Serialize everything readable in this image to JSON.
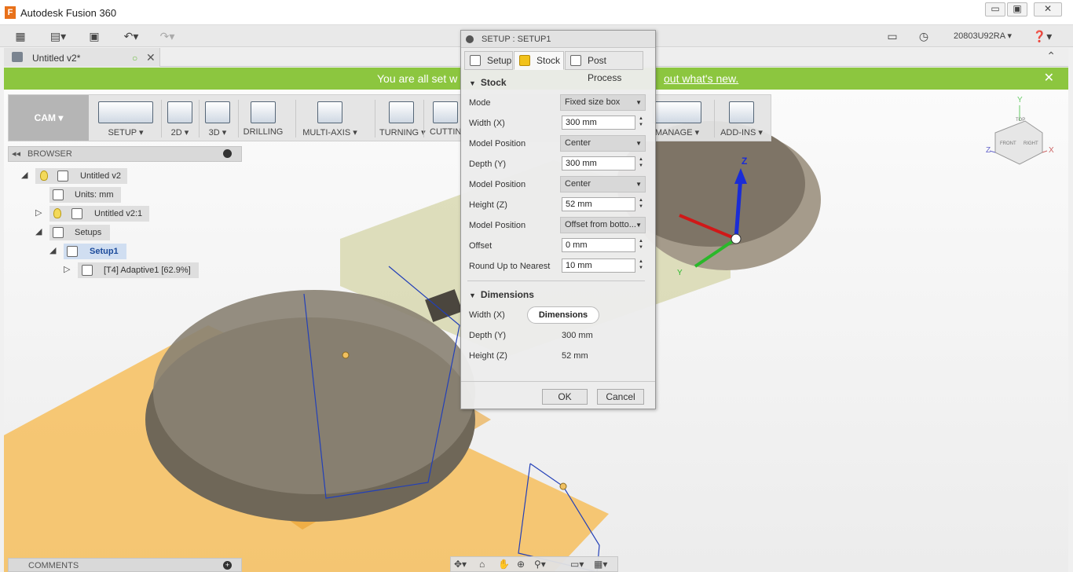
{
  "app": {
    "title": "Autodesk Fusion 360",
    "user": "20803U92RA"
  },
  "window_buttons": {
    "min": "▭",
    "max": "▣",
    "close": "✕"
  },
  "document": {
    "tab_name": "Untitled v2*"
  },
  "banner": {
    "text_left": "You are all set w",
    "text_link": "out what's new.",
    "close": "✕"
  },
  "ribbon": {
    "workspace": "CAM ▾",
    "groups": [
      {
        "label": "SETUP ▾"
      },
      {
        "label": "2D ▾"
      },
      {
        "label": "3D ▾"
      },
      {
        "label": "DRILLING"
      },
      {
        "label": "MULTI-AXIS ▾"
      },
      {
        "label": "TURNING ▾"
      },
      {
        "label": "CUTTIN"
      },
      {
        "label": "MANAGE ▾"
      },
      {
        "label": "ADD-INS ▾"
      }
    ]
  },
  "browser": {
    "title": "BROWSER",
    "tree": [
      {
        "label": "Untitled v2"
      },
      {
        "label": "Units: mm"
      },
      {
        "label": "Untitled v2:1"
      },
      {
        "label": "Setups"
      },
      {
        "label": "Setup1"
      },
      {
        "label": "[T4] Adaptive1 [62.9%]"
      }
    ]
  },
  "comments": {
    "title": "COMMENTS"
  },
  "dialog": {
    "title": "SETUP : SETUP1",
    "tabs": [
      {
        "label": "Setup"
      },
      {
        "label": "Stock"
      },
      {
        "label": "Post Process"
      }
    ],
    "stock_section": "Stock",
    "fields": {
      "mode": {
        "label": "Mode",
        "value": "Fixed size box"
      },
      "width": {
        "label": "Width (X)",
        "value": "300 mm"
      },
      "model_position_x": {
        "label": "Model Position",
        "value": "Center"
      },
      "depth": {
        "label": "Depth (Y)",
        "value": "300 mm"
      },
      "model_position_y": {
        "label": "Model Position",
        "value": "Center"
      },
      "height": {
        "label": "Height (Z)",
        "value": "52 mm"
      },
      "model_position_z": {
        "label": "Model Position",
        "value": "Offset from botto..."
      },
      "offset": {
        "label": "Offset",
        "value": "0 mm"
      },
      "round_up": {
        "label": "Round Up to Nearest",
        "value": "10 mm"
      }
    },
    "dimensions_section": "Dimensions",
    "dimensions": {
      "width_label": "Width (X)",
      "width_tooltip": "Dimensions",
      "depth_label": "Depth (Y)",
      "depth_value": "300 mm",
      "height_label": "Height (Z)",
      "height_value": "52 mm"
    },
    "ok": "OK",
    "cancel": "Cancel"
  },
  "viewcube": {
    "top": "TOP",
    "front": "FRONT",
    "right": "RIGHT",
    "x": "X",
    "y": "Y",
    "z": "Z"
  },
  "triad": {
    "z": "Z",
    "y": "Y"
  },
  "colors": {
    "banner": "#8cc63f",
    "stock": "#f5b13c",
    "accent": "#1c4b9b"
  }
}
